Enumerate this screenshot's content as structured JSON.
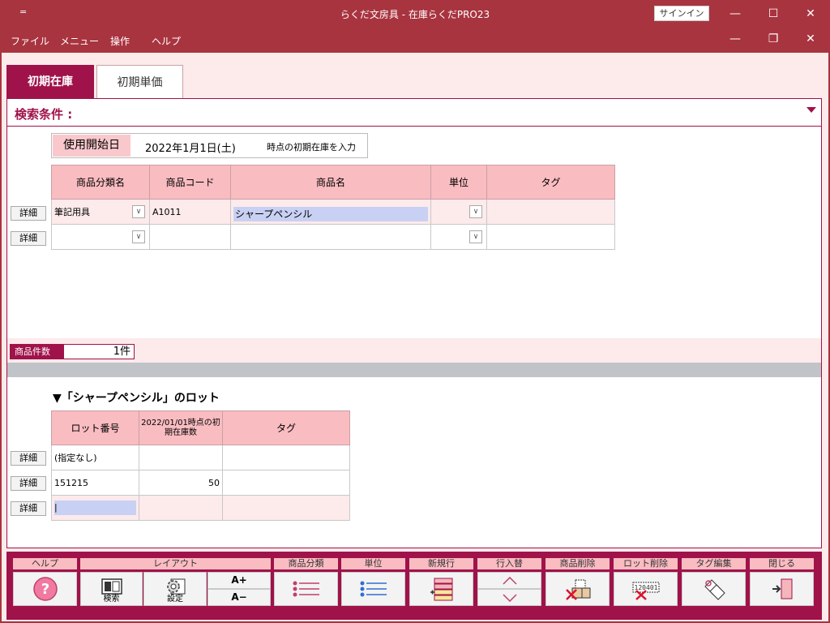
{
  "window": {
    "title": "らくだ文房具 - 在庫らくだPRO23",
    "quick_menu": "=",
    "signin": "サインイン",
    "minimize": "—",
    "maximize": "☐",
    "close": "✕",
    "restore": "❐"
  },
  "menu": {
    "items": [
      "ファイル",
      "メニュー",
      "操作",
      "ヘルプ"
    ]
  },
  "tabs": [
    "初期在庫",
    "初期単価"
  ],
  "search": {
    "label": "検索条件 :"
  },
  "start_date": {
    "label": "使用開始日",
    "value": "2022年1月1日(土)",
    "note": "時点の初期在庫を入力"
  },
  "product_grid": {
    "columns": [
      "商品分類名",
      "商品コード",
      "商品名",
      "単位",
      "タグ"
    ],
    "rows": [
      {
        "detail": "詳細",
        "category": "筆記用具",
        "code": "A1011",
        "name": "シャープペンシル",
        "unit": "",
        "tag": ""
      },
      {
        "detail": "詳細",
        "category": "",
        "code": "",
        "name": "",
        "unit": "",
        "tag": ""
      }
    ]
  },
  "count": {
    "label": "商品件数",
    "value": "1件"
  },
  "lot": {
    "title": "▼「シャープペンシル」のロット",
    "columns": [
      "ロット番号",
      "2022/01/01時点の初期在庫数",
      "タグ"
    ],
    "rows": [
      {
        "detail": "詳細",
        "lot_no": "(指定なし)",
        "qty": "",
        "tag": ""
      },
      {
        "detail": "詳細",
        "lot_no": "151215",
        "qty": "50",
        "tag": ""
      },
      {
        "detail": "詳細",
        "lot_no": "|",
        "qty": "",
        "tag": ""
      }
    ]
  },
  "toolbar": {
    "help": "ヘルプ",
    "layout": "レイアウト",
    "search_btn": "検索",
    "settings_btn": "設定",
    "font_up": "A+",
    "font_down": "A−",
    "category": "商品分類",
    "unit": "単位",
    "new_row": "新規行",
    "reorder": "行入替",
    "delete_product": "商品削除",
    "delete_lot": "ロット削除",
    "edit_tag": "タグ編集",
    "close": "閉じる",
    "lot_icon_text": "120401"
  },
  "colors": {
    "titlebar": "#a8343f",
    "accent": "#a0124a",
    "header_pink": "#f9bcc1",
    "row_pink": "#fdeaeb",
    "highlight_blue": "#c8d1f3"
  }
}
